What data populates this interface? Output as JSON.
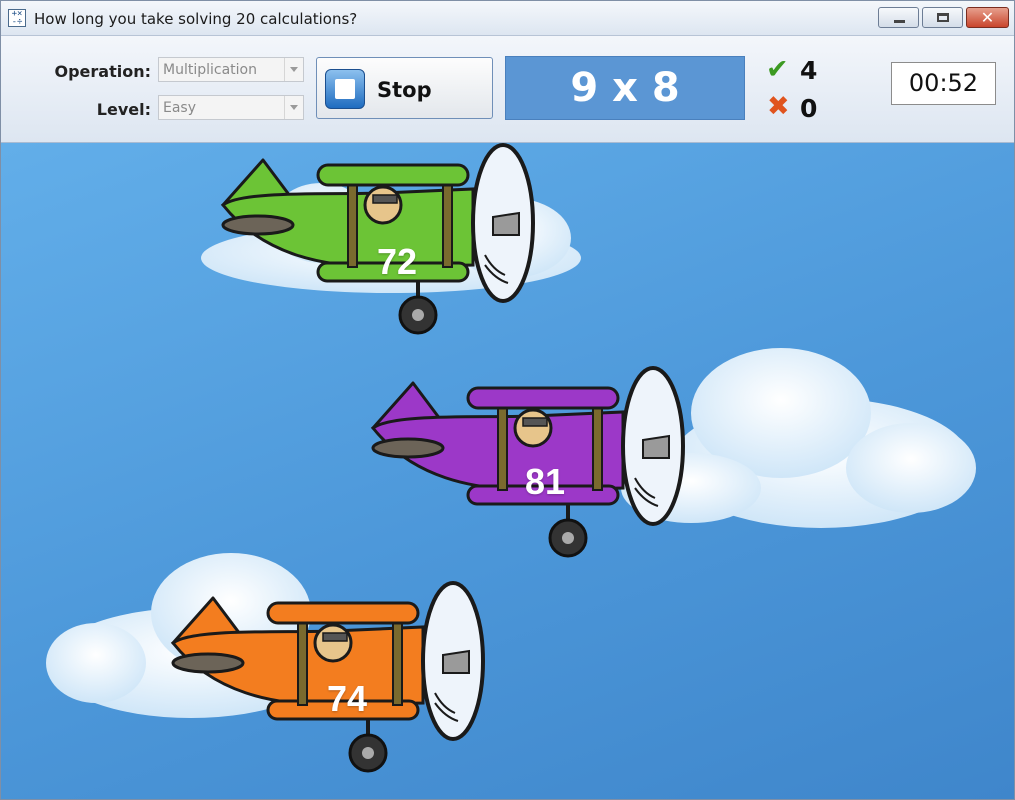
{
  "window": {
    "title": "How long you take solving 20 calculations?",
    "app_icon": "calculator-grid-icon",
    "controls": {
      "minimize_icon": "minimize-icon",
      "maximize_icon": "maximize-icon",
      "close_icon": "close-icon",
      "close_glyph": "✕"
    }
  },
  "toolbar": {
    "operation_label": "Operation:",
    "operation_value": "Multiplication",
    "level_label": "Level:",
    "level_value": "Easy",
    "stop_label": "Stop",
    "stop_icon": "stop-square-icon",
    "question": "9 x 8",
    "correct_icon": "✔",
    "wrong_icon": "✖",
    "correct_count": "4",
    "wrong_count": "0",
    "timer": "00:52",
    "question_bg": "#5b96d4"
  },
  "game": {
    "sky_color": "#4c97d9",
    "planes": [
      {
        "color": "green",
        "fill": "#6cc436",
        "answer": "72"
      },
      {
        "color": "purple",
        "fill": "#9c38c8",
        "answer": "81"
      },
      {
        "color": "orange",
        "fill": "#f37d1f",
        "answer": "74"
      }
    ]
  }
}
